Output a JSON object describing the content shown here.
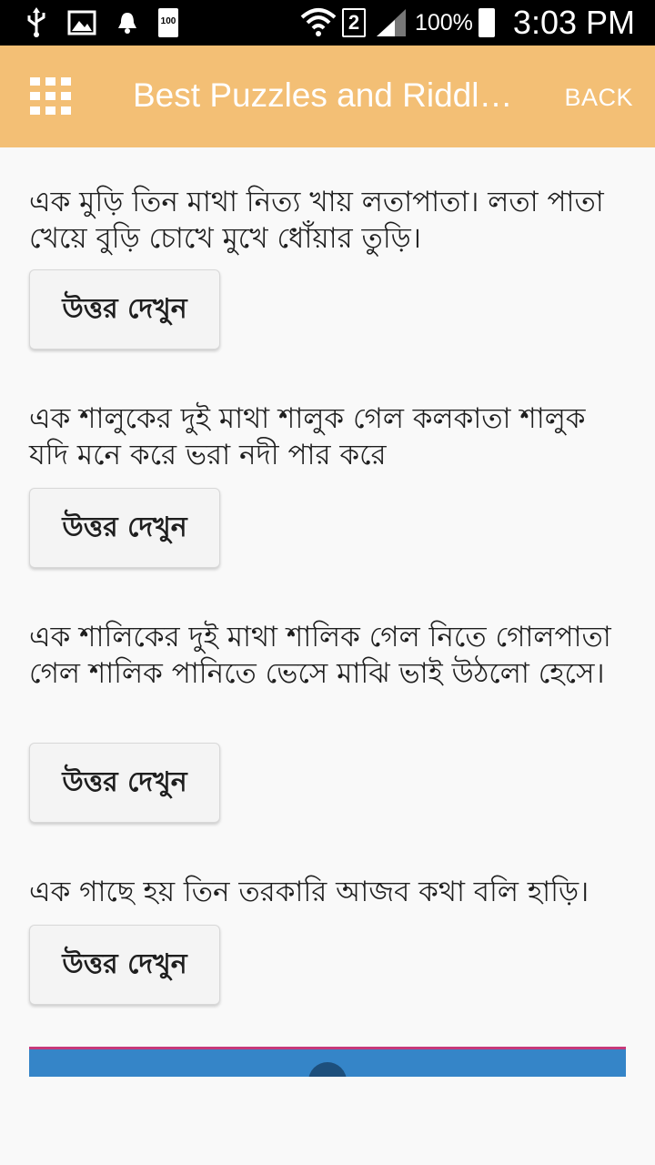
{
  "status_bar": {
    "icons": [
      "usb-icon",
      "image-icon",
      "notification-bell-icon",
      "battery-full-icon",
      "wifi-icon",
      "sim2-icon",
      "signal-icon",
      "battery-icon"
    ],
    "battery_small_label": "100",
    "sim_label": "2",
    "battery_percent": "100%",
    "time": "3:03 PM"
  },
  "app_bar": {
    "title": "Best Puzzles and Riddl…",
    "back_label": "BACK",
    "background": "#f3bf75"
  },
  "riddles": [
    {
      "text": "এক মুড়ি তিন মাথা নিত্য খায় লতাপাতা। লতা পাতা খেয়ে বুড়ি চোখে মুখে ধোঁয়ার তুড়ি।",
      "button_label": "উত্তর দেখুন"
    },
    {
      "text": "এক শালুকের দুই মাথা শালুক গেল কলকাতা শালুক যদি মনে করে ভরা নদী পার করে",
      "button_label": "উত্তর দেখুন"
    },
    {
      "text": "এক শালিকের দুই মাথা শালিক গেল নিতে গোলপাতা গেল শালিক পানিতে ভেসে মাঝি ভাই উঠলো হেসে।",
      "button_label": "উত্তর দেখুন"
    },
    {
      "text": "এক গাছে হয় তিন তরকারি আজব কথা বলি হাড়ি।",
      "button_label": "উত্তর দেখুন"
    }
  ],
  "banner": {
    "color": "#3585c8",
    "icon": "chevron-up-icon"
  }
}
